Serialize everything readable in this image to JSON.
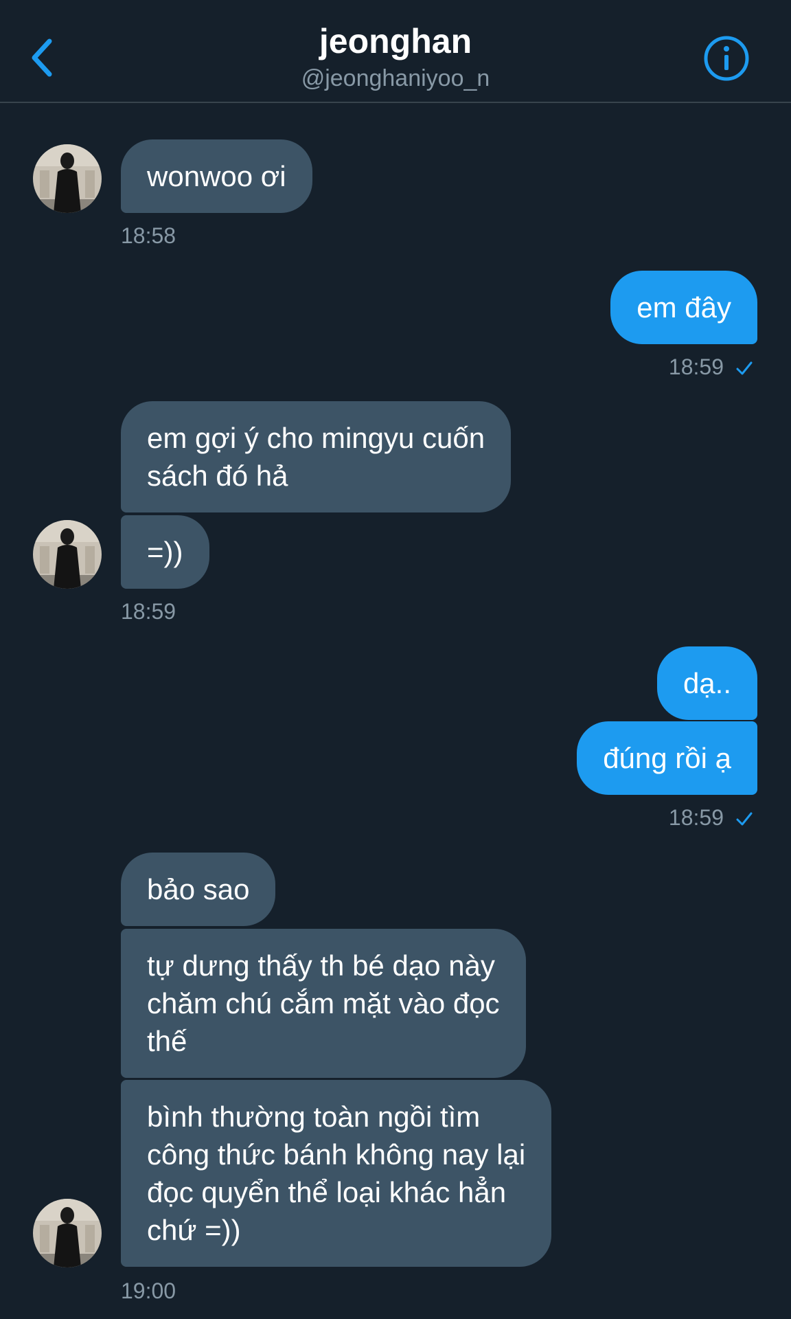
{
  "header": {
    "name": "jeonghan",
    "handle": "@jeonghaniyoo_n",
    "back_icon": "chevron-left-icon",
    "info_icon": "info-icon"
  },
  "colors": {
    "background": "#15202b",
    "incoming_bubble": "#3d5466",
    "outgoing_bubble": "#1d9bf0",
    "accent": "#1d9bf0",
    "muted_text": "#8899a6"
  },
  "messages": [
    {
      "side": "in",
      "text": "wonwoo ơi"
    },
    {
      "side": "out",
      "text": "em đây"
    },
    {
      "side": "in",
      "text": "em gợi ý cho mingyu cuốn\nsách đó hả"
    },
    {
      "side": "in",
      "text": "=))"
    },
    {
      "side": "out",
      "text": "dạ.."
    },
    {
      "side": "out",
      "text": "đúng rồi ạ"
    },
    {
      "side": "in",
      "text": "bảo sao"
    },
    {
      "side": "in",
      "text": "tự dưng thấy th bé dạo này\nchăm chú cắm mặt vào đọc\nthế"
    },
    {
      "side": "in",
      "text": "bình thường toàn ngồi tìm\ncông thức bánh không nay lại\nđọc quyển thể loại khác hẳn\nchứ =))"
    }
  ],
  "timestamps": [
    "18:58",
    "18:59",
    "18:59",
    "18:59",
    "19:00"
  ]
}
